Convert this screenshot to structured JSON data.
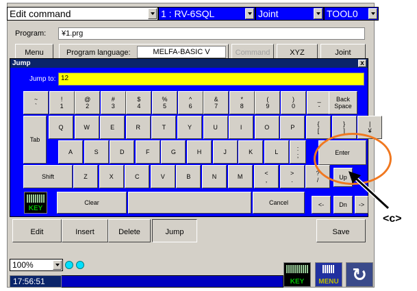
{
  "top_bar": {
    "command": "Edit command",
    "robot": "1 : RV-6SQL",
    "mode": "Joint",
    "tool": "TOOL0"
  },
  "program": {
    "label": "Program:",
    "value": "¥1.prg"
  },
  "toolbar": {
    "menu": "Menu",
    "language_label": "Program language:",
    "language_value": "MELFA-BASIC V",
    "command": "Command",
    "xyz": "XYZ",
    "joint": "Joint"
  },
  "lower_toolbar": {
    "edit": "Edit",
    "insert": "Insert",
    "delete": "Delete",
    "jump": "Jump",
    "save": "Save"
  },
  "dialog": {
    "title": "Jump",
    "close": "x",
    "jump_to_label": "Jump to:",
    "jump_to_value": "12"
  },
  "keyboard": {
    "row1": [
      {
        "top": "~",
        "bottom": "`"
      },
      {
        "top": "!",
        "bottom": "1"
      },
      {
        "top": "@",
        "bottom": "2"
      },
      {
        "top": "#",
        "bottom": "3"
      },
      {
        "top": "$",
        "bottom": "4"
      },
      {
        "top": "%",
        "bottom": "5"
      },
      {
        "top": "^",
        "bottom": "6"
      },
      {
        "top": "&",
        "bottom": "7"
      },
      {
        "top": "*",
        "bottom": "8"
      },
      {
        "top": "(",
        "bottom": "9"
      },
      {
        "top": ")",
        "bottom": "0"
      },
      {
        "top": "_",
        "bottom": "-"
      },
      {
        "top": "+",
        "bottom": "="
      }
    ],
    "backspace": "Back Space",
    "tab": "Tab",
    "row2": [
      "Q",
      "W",
      "E",
      "R",
      "T",
      "Y",
      "U",
      "I",
      "O",
      "P"
    ],
    "row2_brackets": [
      {
        "top": "{",
        "bottom": "["
      },
      {
        "top": "}",
        "bottom": "]"
      },
      {
        "top": "|",
        "bottom": "¥"
      }
    ],
    "row3": [
      "A",
      "S",
      "D",
      "F",
      "G",
      "H",
      "J",
      "K",
      "L"
    ],
    "row3_colon": {
      "top": ":",
      "bottom": ";"
    },
    "enter": "Enter",
    "shift": "Shift",
    "row4": [
      "Z",
      "X",
      "C",
      "V",
      "B",
      "N",
      "M"
    ],
    "row4_punct": [
      {
        "top": "<",
        "bottom": ","
      },
      {
        "top": ">",
        "bottom": "."
      },
      {
        "top": "?",
        "bottom": "/"
      }
    ],
    "up": "Up",
    "key_icon": "KEY",
    "clear": "Clear",
    "cancel": "Cancel",
    "left": "<-",
    "down": "Dn",
    "right": "->"
  },
  "status": {
    "zoom": "100%",
    "time": "17:56:51",
    "key_icon": "KEY",
    "menu_icon": "MENU"
  },
  "annotation": {
    "callout": "<c>",
    "highlight_color": "#f07820"
  }
}
